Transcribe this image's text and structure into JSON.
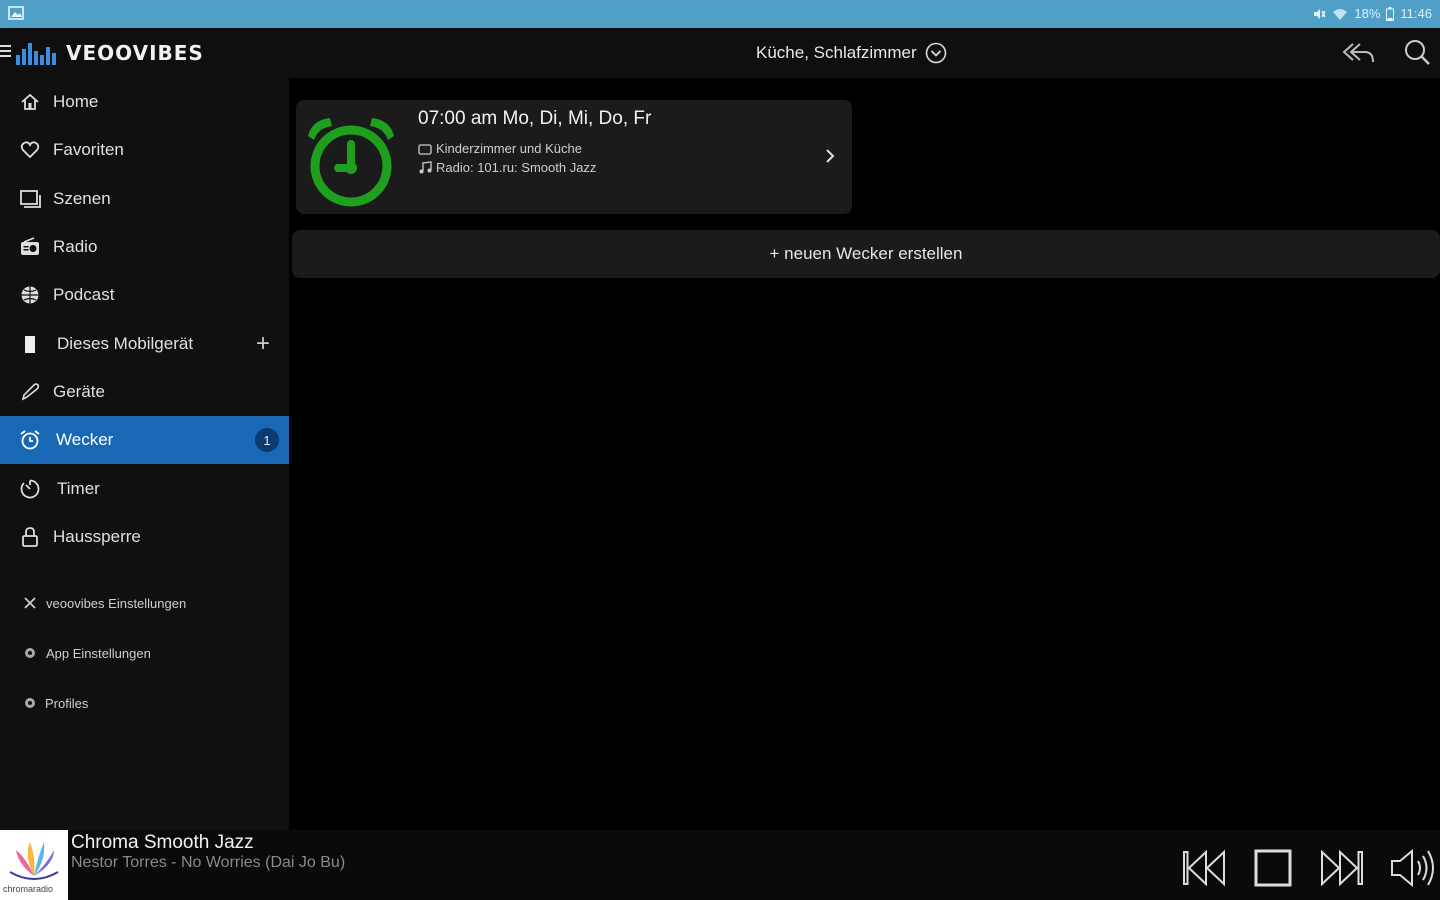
{
  "status_bar": {
    "battery": "18%",
    "time": "11:46"
  },
  "header": {
    "app_name": "VEOOVIBES",
    "room_selection": "Küche, Schlafzimmer"
  },
  "sidebar": {
    "items": [
      {
        "label": "Home",
        "icon": "home-icon"
      },
      {
        "label": "Favoriten",
        "icon": "heart-icon"
      },
      {
        "label": "Szenen",
        "icon": "scenes-icon"
      },
      {
        "label": "Radio",
        "icon": "radio-icon"
      },
      {
        "label": "Podcast",
        "icon": "globe-icon"
      },
      {
        "label": "Dieses Mobilgerät",
        "icon": "phone-icon"
      },
      {
        "label": "Geräte",
        "icon": "link-icon"
      },
      {
        "label": "Wecker",
        "icon": "alarm-icon",
        "badge": "1",
        "active": true
      },
      {
        "label": "Timer",
        "icon": "timer-icon"
      },
      {
        "label": "Haussperre",
        "icon": "lock-icon"
      }
    ],
    "sub_items": [
      {
        "label": "veoovibes Einstellungen",
        "icon": "tools-icon"
      },
      {
        "label": "App Einstellungen",
        "icon": "gear-icon"
      },
      {
        "label": "Profiles",
        "icon": "gear-icon"
      }
    ]
  },
  "alarm": {
    "time_days": "07:00 am Mo, Di, Mi, Do, Fr",
    "rooms": "Kinderzimmer und Küche",
    "source": "Radio: 101.ru: Smooth Jazz",
    "clock_color": "#1ea01e"
  },
  "new_alarm_label": "+ neuen Wecker erstellen",
  "player": {
    "station": "Chroma Smooth Jazz",
    "track": "Nestor Torres - No Worries (Dai Jo Bu)",
    "album_caption": "chromaradio"
  },
  "colors": {
    "accent": "#1968b5",
    "status_bar": "#4f9fc6",
    "alarm_green": "#1ea01e"
  }
}
